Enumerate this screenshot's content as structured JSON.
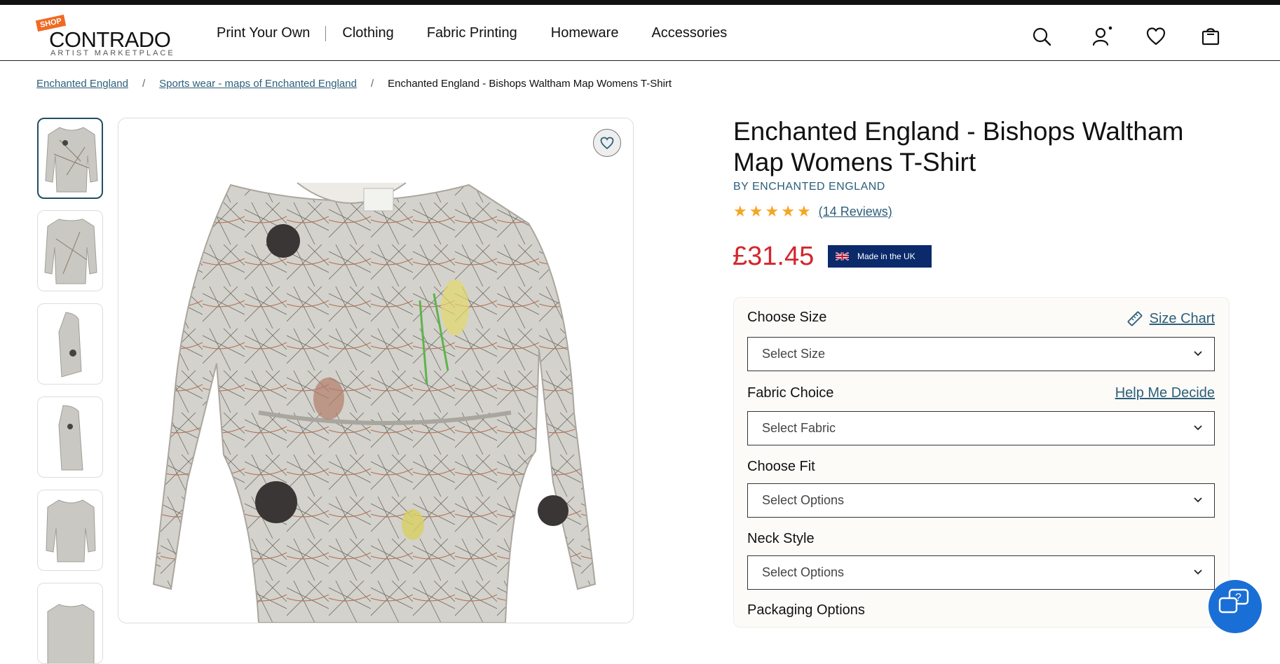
{
  "logo": {
    "tag": "SHOP",
    "name": "CONTRADO",
    "sub": "ARTIST MARKETPLACE"
  },
  "nav": [
    "Print Your Own",
    "Clothing",
    "Fabric Printing",
    "Homeware",
    "Accessories"
  ],
  "header_icons": [
    "search-icon",
    "account-icon",
    "heart-icon",
    "bag-icon"
  ],
  "breadcrumb": [
    "Enchanted England",
    "Sports wear - maps of Enchanted England",
    "Enchanted England - Bishops Waltham Map Womens T-Shirt"
  ],
  "product": {
    "title": "Enchanted England - Bishops Waltham Map Womens T-Shirt",
    "brand": "BY ENCHANTED ENGLAND",
    "rating": 5,
    "reviews": "(14 Reviews)",
    "price": "£31.45",
    "badge": "Made in the UK"
  },
  "options": {
    "size": {
      "label": "Choose Size",
      "link": "Size Chart",
      "value": "Select Size"
    },
    "fabric": {
      "label": "Fabric Choice",
      "link": "Help Me Decide",
      "value": "Select Fabric"
    },
    "fit": {
      "label": "Choose Fit",
      "value": "Select Options"
    },
    "neck": {
      "label": "Neck Style",
      "value": "Select Options"
    },
    "packaging": {
      "label": "Packaging Options"
    }
  },
  "colors": {
    "accent": "#2c5f7a",
    "price": "#d4252c",
    "badge": "#0a2a6b",
    "chat": "#1a6fd6"
  }
}
